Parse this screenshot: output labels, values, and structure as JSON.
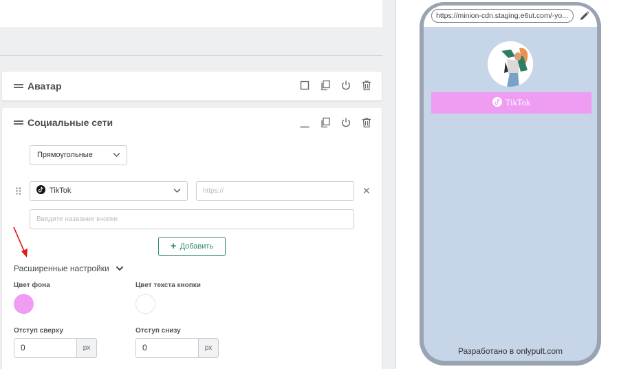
{
  "editor": {
    "avatar_block": {
      "title": "Аватар"
    },
    "social_block": {
      "title": "Социальные сети",
      "shape_select": "Прямоугольные",
      "network_select": "TikTok",
      "url_placeholder": "https://",
      "button_name_placeholder": "Введите название кнопки",
      "add_button": "Добавить",
      "advanced_settings": "Расширенные настройки",
      "bg_color_label": "Цвет фона",
      "text_color_label": "Цвет текста кнопки",
      "padding_top_label": "Отступ сверху",
      "padding_bottom_label": "Отступ снизу",
      "padding_top_value": "0",
      "padding_bottom_value": "0",
      "unit": "px"
    }
  },
  "colors": {
    "button_bg": "#ef9cf3",
    "button_text": "#ffffff",
    "page_bg": "#c7d5e8",
    "accent_green": "#2e8a66",
    "arrow_red": "#e0191a"
  },
  "preview": {
    "url": "https://minion-cdn.staging.e6ut.com/-yo...",
    "link_button": "TikTok",
    "footer": "Разработано в onlypult.com"
  },
  "icons": [
    "drag-handle-icon",
    "square-icon",
    "copy-icon",
    "power-icon",
    "trash-icon",
    "minimize-icon",
    "chevron-down-icon",
    "tiktok-icon",
    "grip-icon",
    "close-icon",
    "plus-icon",
    "pencil-icon",
    "arrow-annotation-icon"
  ]
}
